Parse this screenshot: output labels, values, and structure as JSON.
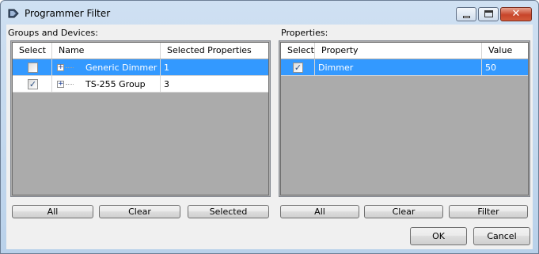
{
  "window": {
    "title": "Programmer Filter",
    "close_glyph": "✕"
  },
  "groups_section": {
    "label": "Groups and Devices:",
    "columns": [
      "Select",
      "Name",
      "Selected Properties"
    ],
    "rows": [
      {
        "checked": false,
        "name": "Generic Dimmer ...",
        "selected_properties": "1",
        "selected": true
      },
      {
        "checked": true,
        "name": "TS-255 Group",
        "selected_properties": "3",
        "selected": false
      }
    ],
    "buttons": {
      "all": "All",
      "clear": "Clear",
      "selected": "Selected"
    }
  },
  "properties_section": {
    "label": "Properties:",
    "columns": [
      "Select",
      "Property",
      "Value"
    ],
    "rows": [
      {
        "checked": true,
        "property": "Dimmer",
        "value": "50",
        "selected": true
      }
    ],
    "buttons": {
      "all": "All",
      "clear": "Clear",
      "filter": "Filter"
    }
  },
  "footer": {
    "ok": "OK",
    "cancel": "Cancel"
  },
  "glyphs": {
    "check": "✓",
    "expand": "+"
  }
}
